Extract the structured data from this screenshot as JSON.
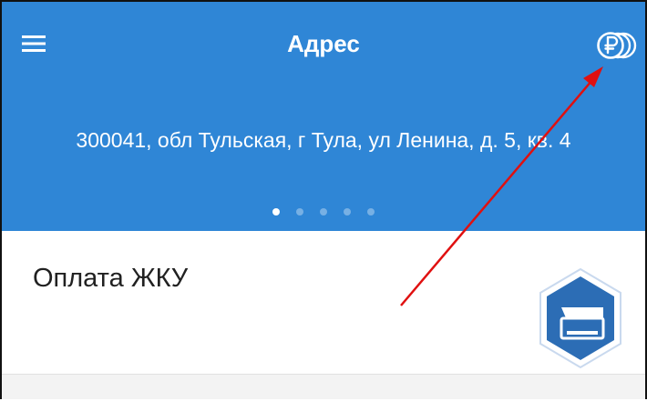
{
  "appbar": {
    "title": "Адрес",
    "menu_icon": "hamburger-menu-icon",
    "payments_icon": "ruble-coins-icon",
    "background_color": "#2F86D6"
  },
  "address": {
    "text": "300041, обл Тульская, г Тула, ул Ленина, д. 5, кв. 4",
    "pager_count": 5,
    "pager_active_index": 0
  },
  "card": {
    "title": "Оплата ЖКУ",
    "icon": "wallet-hexagon-icon",
    "icon_color": "#2C6DB5"
  },
  "annotation": {
    "arrow_color": "#E01010"
  }
}
